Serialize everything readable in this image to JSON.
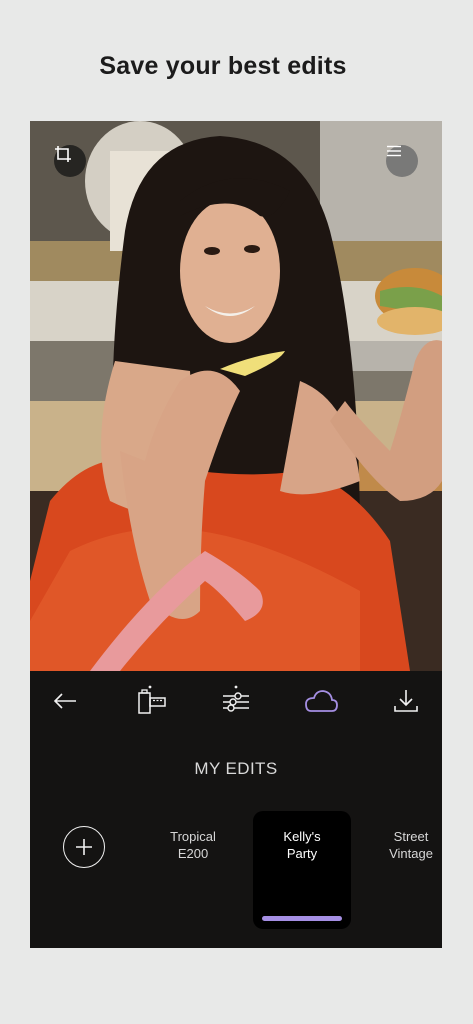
{
  "headline": "Save your best edits",
  "photo": {
    "alt": "Woman in orange dress holding a french fry and a sandwich"
  },
  "top_controls": {
    "crop_icon": "crop-icon",
    "menu_icon": "hamburger-menu-icon"
  },
  "toolbar": {
    "items": [
      {
        "icon": "back-arrow-icon"
      },
      {
        "icon": "film-icon"
      },
      {
        "icon": "sliders-icon"
      },
      {
        "icon": "cloud-icon",
        "active": true
      },
      {
        "icon": "download-icon"
      }
    ],
    "active_color": "#a58fe3"
  },
  "section_title": "MY EDITS",
  "presets": [
    {
      "line1": "Tropical",
      "line2": "E200"
    },
    {
      "line1": "Kelly's",
      "line2": "Party",
      "selected": true
    },
    {
      "line1": "Street",
      "line2": "Vintage"
    }
  ],
  "add_icon": "plus-icon"
}
